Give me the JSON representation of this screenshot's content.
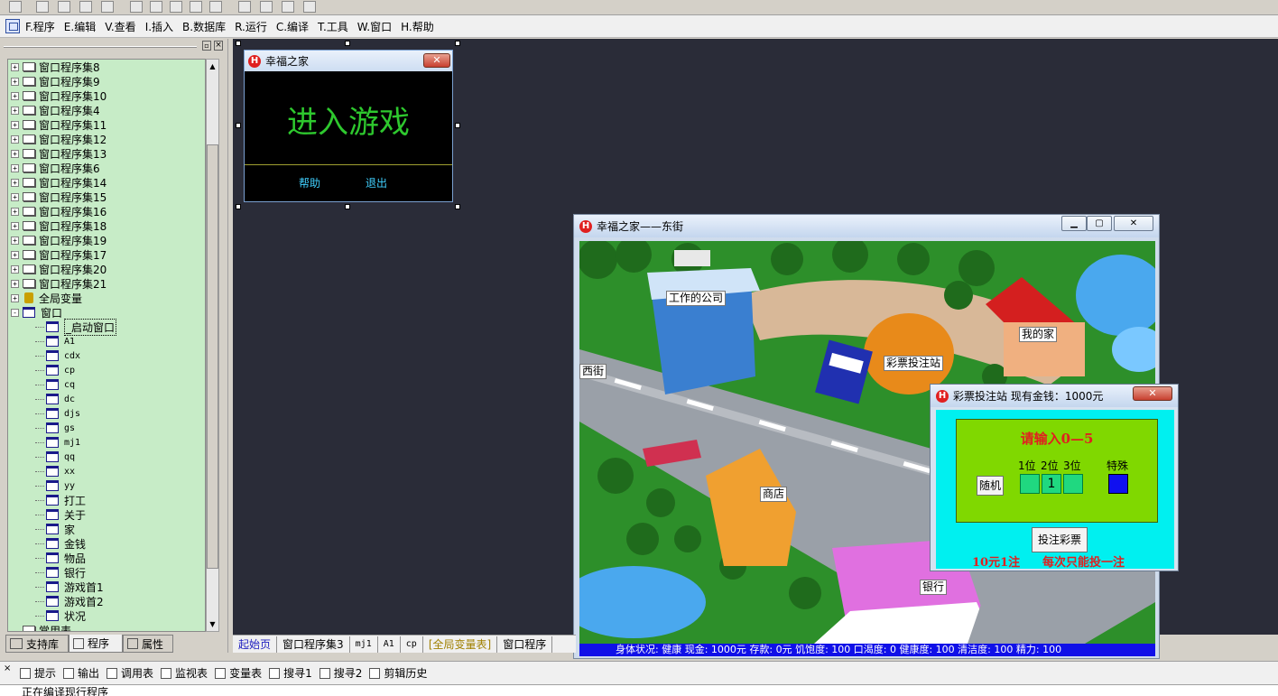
{
  "menu": [
    "F.程序",
    "E.编辑",
    "V.查看",
    "I.插入",
    "B.数据库",
    "R.运行",
    "C.编译",
    "T.工具",
    "W.窗口",
    "H.帮助"
  ],
  "tree": {
    "items": [
      {
        "label": "窗口程序集8",
        "type": "module",
        "expander": "+"
      },
      {
        "label": "窗口程序集9",
        "type": "module",
        "expander": "+"
      },
      {
        "label": "窗口程序集10",
        "type": "module",
        "expander": "+"
      },
      {
        "label": "窗口程序集4",
        "type": "module",
        "expander": "+"
      },
      {
        "label": "窗口程序集11",
        "type": "module",
        "expander": "+"
      },
      {
        "label": "窗口程序集12",
        "type": "module",
        "expander": "+"
      },
      {
        "label": "窗口程序集13",
        "type": "module",
        "expander": "+"
      },
      {
        "label": "窗口程序集6",
        "type": "module",
        "expander": "+"
      },
      {
        "label": "窗口程序集14",
        "type": "module",
        "expander": "+"
      },
      {
        "label": "窗口程序集15",
        "type": "module",
        "expander": "+"
      },
      {
        "label": "窗口程序集16",
        "type": "module",
        "expander": "+"
      },
      {
        "label": "窗口程序集18",
        "type": "module",
        "expander": "+"
      },
      {
        "label": "窗口程序集19",
        "type": "module",
        "expander": "+"
      },
      {
        "label": "窗口程序集17",
        "type": "module",
        "expander": "+"
      },
      {
        "label": "窗口程序集20",
        "type": "module",
        "expander": "+"
      },
      {
        "label": "窗口程序集21",
        "type": "module",
        "expander": "+"
      },
      {
        "label": "全局变量",
        "type": "global",
        "expander": "+"
      },
      {
        "label": "窗口",
        "type": "folder",
        "expander": "-"
      }
    ],
    "windows": [
      "_启动窗口",
      "A1",
      "cdx",
      "cp",
      "cq",
      "dc",
      "djs",
      "gs",
      "mj1",
      "qq",
      "xx",
      "yy",
      "打工",
      "关于",
      "家",
      "金钱",
      "物品",
      "银行",
      "游戏首1",
      "游戏首2",
      "状况"
    ],
    "cutoff": "常用表"
  },
  "left_tabs": [
    "支持库",
    "程序",
    "属性"
  ],
  "start_window": {
    "title": "幸福之家",
    "enter_label": "进入游戏",
    "help_label": "帮助",
    "exit_label": "退出",
    "close_symbol": "✕"
  },
  "game_window": {
    "title": "幸福之家——东街",
    "labels": {
      "company": "工作的公司",
      "home": "我的家",
      "west": "西街",
      "lottery": "彩票投注站",
      "shop": "商店",
      "bank": "银行"
    },
    "status": "身体状况: 健康 现金: 1000元 存款: 0元 饥饱度: 100 口渴度: 0 健康度: 100 清洁度: 100 精力: 100"
  },
  "lottery_window": {
    "title": "彩票投注站  现有金钱：1000元",
    "prompt": "请输入0—5",
    "pos1": "1位",
    "pos2": "2位",
    "pos3": "3位",
    "special": "特殊",
    "random_label": "随机",
    "digit2": "1",
    "submit_label": "投注彩票",
    "price_note": "10元1注",
    "limit_note": "每次只能投一注"
  },
  "doc_tabs": [
    "起始页",
    "窗口程序集3",
    "mj1",
    "A1",
    "cp",
    "[全局变量表]",
    "窗口程序"
  ],
  "bottom_bar": [
    "提示",
    "输出",
    "调用表",
    "监视表",
    "变量表",
    "搜寻1",
    "搜寻2",
    "剪辑历史"
  ],
  "output_text": "正在编译现行程序",
  "colors": {
    "tree_bg": "#c7ecc7",
    "workspace": "#2a2c38",
    "enter_text": "#2ec82e",
    "link_text": "#40d0ff",
    "status_bg": "#1010e8",
    "lottery_bg": "#00f0f0",
    "lottery_panel": "#80d800",
    "prompt_text": "#e02020"
  }
}
